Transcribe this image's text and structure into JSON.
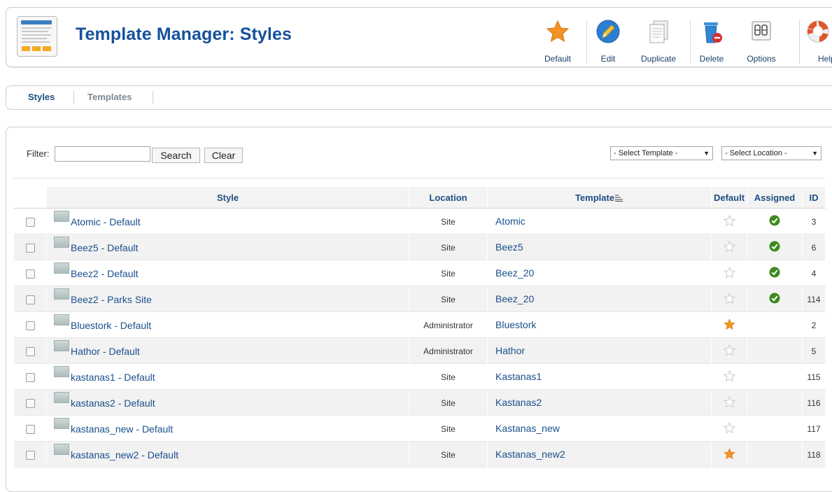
{
  "page": {
    "title": "Template Manager: Styles"
  },
  "toolbar": {
    "default_label": "Default",
    "edit_label": "Edit",
    "duplicate_label": "Duplicate",
    "delete_label": "Delete",
    "options_label": "Options",
    "help_label": "Help"
  },
  "tabs": {
    "styles": "Styles",
    "templates": "Templates"
  },
  "filter": {
    "label": "Filter:",
    "value": "",
    "search_button": "Search",
    "clear_button": "Clear",
    "template_select": "- Select Template -",
    "location_select": "- Select Location -"
  },
  "table": {
    "headers": {
      "style": "Style",
      "location": "Location",
      "template": "Template",
      "default": "Default",
      "assigned": "Assigned",
      "id": "ID"
    },
    "rows": [
      {
        "style": "Atomic - Default",
        "location": "Site",
        "template": "Atomic",
        "default": false,
        "assigned": true,
        "id": "3"
      },
      {
        "style": "Beez5 - Default",
        "location": "Site",
        "template": "Beez5",
        "default": false,
        "assigned": true,
        "id": "6"
      },
      {
        "style": "Beez2 - Default",
        "location": "Site",
        "template": "Beez_20",
        "default": false,
        "assigned": true,
        "id": "4"
      },
      {
        "style": "Beez2 - Parks Site",
        "location": "Site",
        "template": "Beez_20",
        "default": false,
        "assigned": true,
        "id": "114"
      },
      {
        "style": "Bluestork - Default",
        "location": "Administrator",
        "template": "Bluestork",
        "default": true,
        "assigned": false,
        "id": "2"
      },
      {
        "style": "Hathor - Default",
        "location": "Administrator",
        "template": "Hathor",
        "default": false,
        "assigned": false,
        "id": "5"
      },
      {
        "style": "kastanas1 - Default",
        "location": "Site",
        "template": "Kastanas1",
        "default": false,
        "assigned": false,
        "id": "115"
      },
      {
        "style": "kastanas2 - Default",
        "location": "Site",
        "template": "Kastanas2",
        "default": false,
        "assigned": false,
        "id": "116"
      },
      {
        "style": "kastanas_new - Default",
        "location": "Site",
        "template": "Kastanas_new",
        "default": false,
        "assigned": false,
        "id": "117"
      },
      {
        "style": "kastanas_new2 - Default",
        "location": "Site",
        "template": "Kastanas_new2",
        "default": true,
        "assigned": false,
        "id": "118"
      }
    ]
  },
  "colors": {
    "title": "#16529c",
    "link": "#1a4f8b",
    "tab_active": "#1e4e82",
    "tab_inactive": "#7a8793",
    "star_default": "#f29423",
    "star_empty": "#c9c9c9",
    "check": "#3a8a1d"
  },
  "icons": {
    "page": "template-manager-icon",
    "default": "star-icon",
    "edit": "pencil-icon",
    "duplicate": "document-copy-icon",
    "delete": "trash-can-icon",
    "options": "options-panel-icon",
    "help": "life-ring-icon",
    "row_thumbnail": "template-thumbnail-icon",
    "default_on": "star-filled-icon",
    "default_off": "star-outline-icon",
    "assigned": "check-circle-icon",
    "sort": "sort-icon"
  }
}
